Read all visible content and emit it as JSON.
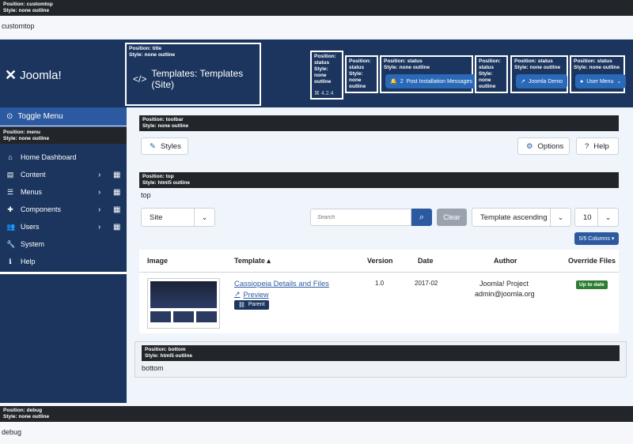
{
  "customtop": {
    "pos": "Position: customtop",
    "style": "Style: none outline",
    "text": "customtop"
  },
  "header": {
    "logo": "Joomla!",
    "title_pos": "Position: title",
    "title_style": "Style: none outline",
    "title": "Templates: Templates (Site)",
    "status_boxes": [
      {
        "l1": "Position:",
        "l2": "status",
        "l3": "Style:",
        "l4": "none",
        "l5": "outline",
        "version": "⌘ 4.2.4"
      },
      {
        "l1": "Position:",
        "l2": "status",
        "l3": "Style:",
        "l4": "none",
        "l5": "outline"
      },
      {
        "pos": "Position: status",
        "style": "Style: none outline",
        "count": "2",
        "label": "Post Installation Messages"
      },
      {
        "l1": "Position:",
        "l2": "status",
        "l3": "Style:",
        "l4": "none",
        "l5": "outline"
      },
      {
        "pos": "Position: status",
        "style": "Style: none outline",
        "label": "Joomla Demo"
      },
      {
        "pos": "Position: status",
        "style": "Style: none outline",
        "label": "User Menu"
      }
    ]
  },
  "sidebar": {
    "toggle": "Toggle Menu",
    "menu_pos": "Position: menu",
    "menu_style": "Style: none outline",
    "items": [
      {
        "label": "Home Dashboard"
      },
      {
        "label": "Content"
      },
      {
        "label": "Menus"
      },
      {
        "label": "Components"
      },
      {
        "label": "Users"
      },
      {
        "label": "System"
      },
      {
        "label": "Help"
      }
    ]
  },
  "toolbar": {
    "pos": "Position: toolbar",
    "style": "Style: none outline",
    "styles_btn": "Styles",
    "options_btn": "Options",
    "help_btn": "Help"
  },
  "top": {
    "pos": "Position: top",
    "style": "Style: html5 outline",
    "text": "top"
  },
  "filters": {
    "client": "Site",
    "search_placeholder": "Search",
    "clear": "Clear",
    "ordering": "Template ascending",
    "limit": "10",
    "columns": "5/5 Columns ▾"
  },
  "table": {
    "headers": {
      "image": "Image",
      "template": "Template ▴",
      "version": "Version",
      "date": "Date",
      "author": "Author",
      "override": "Override Files"
    },
    "row": {
      "name": "Cassiopeia Details and Files",
      "preview": "Preview",
      "parent": "Parent",
      "version": "1.0",
      "date": "2017-02",
      "author": "Joomla! Project",
      "email": "admin@joomla.org",
      "override": "Up to date"
    }
  },
  "bottom": {
    "pos": "Position: bottom",
    "style": "Style: html5 outline",
    "text": "bottom"
  },
  "debug": {
    "pos": "Position: debug",
    "style": "Style: none outline",
    "text": "debug"
  },
  "colors": {
    "header_bg": "#1b355e",
    "accent": "#2c5aa0",
    "success": "#2f7d32"
  }
}
